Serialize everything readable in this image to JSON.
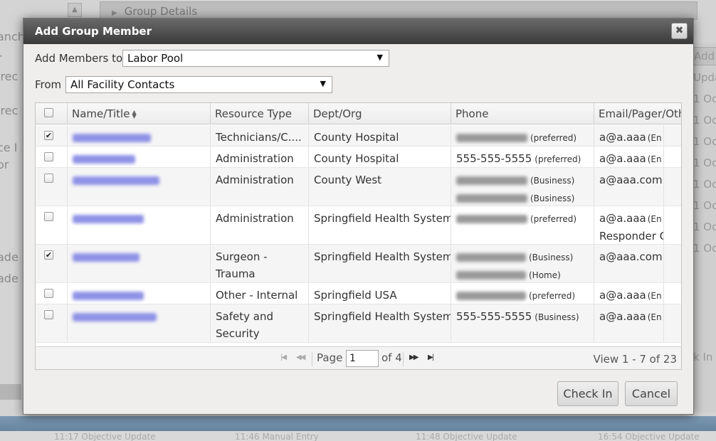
{
  "background": {
    "top_panel_title": "Group Details",
    "left_fragments": [
      "anch",
      "r",
      "irec",
      "irec",
      "ce I",
      "or",
      "ade",
      "ade"
    ],
    "right_add_label": "Add",
    "right_header": "Upda",
    "right_rows": [
      "1 Oc",
      "1 Oc",
      "1 Oc",
      "1 Oc",
      "1 Oc",
      "1 Oc",
      "1 Oc",
      "1 Oc"
    ],
    "right_link": "k In /",
    "bottom_row": [
      "11:17 Objective Update",
      "11:46 Manual Entry",
      "11:48 Objective Update",
      "16:54 Objective Update"
    ]
  },
  "dialog": {
    "title": "Add Group Member",
    "close_label": "✖",
    "add_members_label": "Add Members to",
    "add_members_value": "Labor Pool",
    "from_label": "From",
    "from_value": "All Facility Contacts",
    "columns": {
      "name": "Name/Title",
      "resource_type": "Resource Type",
      "dept": "Dept/Org",
      "phone": "Phone",
      "email": "Email/Pager/Oth"
    },
    "rows": [
      {
        "checked": true,
        "resource_type": "Technicians/C....",
        "dept": "County Hospital",
        "phones": [
          {
            "number": "",
            "type": "(preferred)"
          }
        ],
        "emails": [
          {
            "text": "a@a.aaa",
            "suffix": "(En"
          }
        ]
      },
      {
        "checked": false,
        "resource_type": "Administration",
        "dept": "County Hospital",
        "phones": [
          {
            "number": "555-555-5555",
            "type": "(preferred)"
          }
        ],
        "emails": [
          {
            "text": "a@a.aaa",
            "suffix": "(En"
          }
        ]
      },
      {
        "checked": false,
        "resource_type": "Administration",
        "dept": "County West",
        "phones": [
          {
            "number": "",
            "type": "(Business)"
          },
          {
            "number": "",
            "type": "(Business)"
          }
        ],
        "emails": [
          {
            "text": "a@aaa.com",
            "suffix": ""
          }
        ]
      },
      {
        "checked": false,
        "resource_type": "Administration",
        "dept": "Springfield Health System C",
        "phones": [
          {
            "number": "",
            "type": "(preferred)"
          }
        ],
        "emails": [
          {
            "text": "a@a.aaa",
            "suffix": "(En"
          },
          {
            "text": "Responder C",
            "suffix": ""
          }
        ]
      },
      {
        "checked": true,
        "resource_type": "Surgeon - Trauma",
        "dept": "Springfield Health System C",
        "phones": [
          {
            "number": "",
            "type": "(Business)"
          },
          {
            "number": "",
            "type": "(Home)"
          }
        ],
        "emails": [
          {
            "text": "a@aaa.com",
            "suffix": ""
          }
        ]
      },
      {
        "checked": false,
        "resource_type": "Other - Internal",
        "dept": "Springfield USA",
        "phones": [
          {
            "number": "",
            "type": "(preferred)"
          }
        ],
        "emails": [
          {
            "text": "a@a.aaa",
            "suffix": "(En"
          }
        ]
      },
      {
        "checked": false,
        "resource_type": "Safety and Security",
        "dept": "Springfield Health System C",
        "phones": [
          {
            "number": "555-555-5555",
            "type": "(Business)"
          }
        ],
        "emails": [
          {
            "text": "a@a.aaa",
            "suffix": "(En"
          }
        ]
      }
    ],
    "pager": {
      "page_label": "Page",
      "page_value": "1",
      "of_label": "of 4",
      "view_label": "View 1 - 7 of 23"
    },
    "check_in_label": "Check In",
    "cancel_label": "Cancel"
  },
  "colors": {
    "titlebar_top": "#6a6a6a",
    "titlebar_bottom": "#3a3a3a",
    "dialog_bg": "#f0eeec",
    "blurred_name": "#8f92e6"
  },
  "icons": {
    "close": "close-icon",
    "sort": "sort-icon",
    "dropdown": "dropdown-arrow-icon",
    "pager": [
      "first-page-icon",
      "prev-page-icon",
      "next-page-icon",
      "last-page-icon"
    ]
  }
}
